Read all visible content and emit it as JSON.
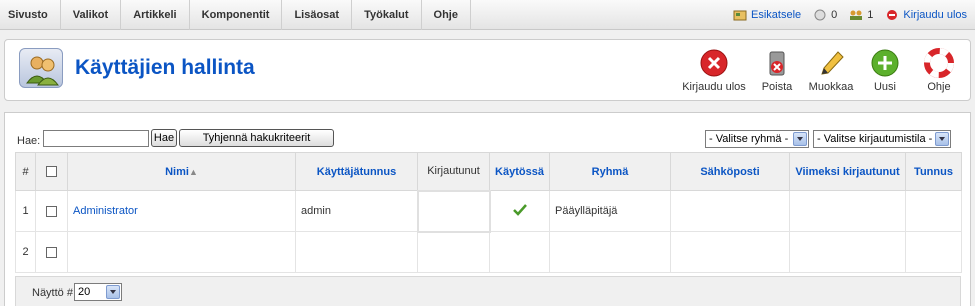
{
  "menu": [
    "Sivusto",
    "Valikot",
    "Artikkeli",
    "Komponentit",
    "Lisäosat",
    "Työkalut",
    "Ohje"
  ],
  "status": {
    "preview": "Esikatsele",
    "messages": "0",
    "users": "1",
    "logout": "Kirjaudu ulos"
  },
  "header": {
    "title": "Käyttäjien hallinta",
    "toolbar": {
      "logout": "Kirjaudu ulos",
      "delete": "Poista",
      "edit": "Muokkaa",
      "new": "Uusi",
      "help": "Ohje"
    }
  },
  "filter": {
    "label": "Hae:",
    "value": "",
    "go": "Hae",
    "reset": "Tyhjennä hakukriteerit",
    "group_select": "- Valitse ryhmä -",
    "logged_select": "- Valitse kirjautumistila -"
  },
  "table": {
    "headers": {
      "num": "#",
      "name": "Nimi",
      "username": "Käyttäjätunnus",
      "loggedin": "Kirjautunut",
      "enabled": "Käytössä",
      "group": "Ryhmä",
      "email": "Sähköposti",
      "lastvisit": "Viimeksi kirjautunut",
      "id": "Tunnus"
    },
    "rows": [
      {
        "num": "1",
        "name": "Administrator",
        "username": "admin",
        "group": "Pääylläpitäjä"
      },
      {
        "num": "2",
        "name": "",
        "username": "",
        "group": ""
      }
    ]
  },
  "footer": {
    "label": "Näyttö #",
    "limit": "20"
  },
  "colors": {
    "link": "#0b55c4",
    "header_bg": "#f0f0f0"
  }
}
